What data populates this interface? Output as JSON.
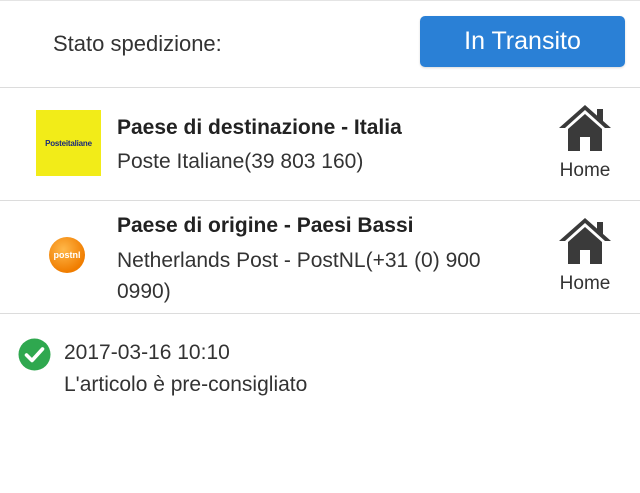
{
  "status": {
    "label": "Stato spedizione:",
    "badge": "In Transito",
    "badge_color": "#2a80d6"
  },
  "carriers": [
    {
      "title": "Paese di destinazione - Italia",
      "detail": "Poste Italiane(39 803 160)",
      "logo_text": "Posteitaliane",
      "logo_color": "#f2ec18",
      "home_label": "Home",
      "icon": "home-icon"
    },
    {
      "title": "Paese di origine - Paesi Bassi",
      "detail": "Netherlands Post - PostNL(+31 (0) 900 0990)",
      "logo_text": "postnl",
      "logo_color": "#f07d00",
      "home_label": "Home",
      "icon": "home-icon"
    }
  ],
  "events": [
    {
      "time": "2017-03-16 10:10",
      "description": "L'articolo è pre-consigliato",
      "icon": "check-circle-icon",
      "icon_color": "#2fa84f"
    }
  ]
}
